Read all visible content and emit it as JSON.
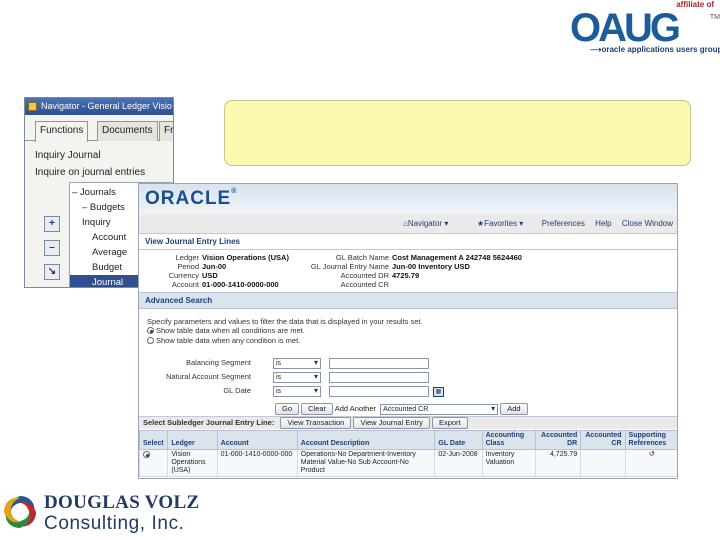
{
  "oaug": {
    "affiliate": "affiliate of",
    "word": "OAUG",
    "tagline": "oracle applications users group",
    "tm": "TM"
  },
  "navigator": {
    "title": "Navigator - General Ledger Visio",
    "tabs": [
      "Functions",
      "Documents",
      "Fr"
    ],
    "items": [
      "Inquiry Journal",
      "Inquire on journal entries"
    ],
    "tree": [
      {
        "label": "– Journals"
      },
      {
        "label": "– Budgets"
      },
      {
        "label": "Inquiry"
      },
      {
        "label": "Account"
      },
      {
        "label": "Average"
      },
      {
        "label": "Budget"
      },
      {
        "label": "Journal"
      }
    ],
    "buttons": [
      "+",
      "–",
      "↘"
    ]
  },
  "oracle": {
    "logo": "ORACLE",
    "links": {
      "navigator": "Navigator",
      "favorites": "Favorites",
      "preferences": "Preferences",
      "help": "Help",
      "close": "Close Window"
    },
    "section_title": "View Journal Entry Lines",
    "left_fields": [
      {
        "label": "Ledger",
        "value": "Vision Operations (USA)"
      },
      {
        "label": "Period",
        "value": "Jun-00"
      },
      {
        "label": "Currency",
        "value": "USD"
      },
      {
        "label": "Account",
        "value": "01-000-1410-0000-000"
      }
    ],
    "right_fields": [
      {
        "label": "GL Batch Name",
        "value": "Cost Management A 242748 5624460"
      },
      {
        "label": "GL Journal Entry Name",
        "value": "Jun-00 Inventory USD"
      },
      {
        "label": "Accounted DR",
        "value": "4725.79"
      },
      {
        "label": "Accounted CR",
        "value": ""
      }
    ],
    "advanced_search": "Advanced Search",
    "hint": "Specify parameters and values to filter the data that is displayed in your results set.",
    "radio_all": "Show table data when all conditions are met.",
    "radio_any": "Show table data when any condition is met.",
    "criteria": [
      {
        "label": "Balancing Segment",
        "op": "is"
      },
      {
        "label": "Natural Account Segment",
        "op": "is"
      },
      {
        "label": "GL Date",
        "op": "is"
      }
    ],
    "actions": {
      "go": "Go",
      "clear": "Clear",
      "add_another": "Add Another",
      "add_field": "Accounted CR",
      "add": "Add"
    },
    "toolbar": {
      "label": "Select Subledger Journal Entry Line:",
      "view_transaction": "View Transaction",
      "view_journal_entry": "View Journal Entry",
      "export": "Export"
    },
    "table": {
      "headers": [
        "Select",
        "Ledger",
        "Account",
        "Account Description",
        "GL Date",
        "Accounting Class",
        "Accounted DR",
        "Accounted CR",
        "Supporting References"
      ],
      "row": [
        "",
        "Vision Operations (USA)",
        "01-000-1410-0000-000",
        "Operations-No Department-Inventory Material Value-No Sub Account-No Product",
        "02-Jun-2008",
        "Inventory Valuation",
        "4,725.79",
        "",
        "↺"
      ]
    }
  },
  "douglas": {
    "line1": "DOUGLAS VOLZ",
    "line2": "Consulting, Inc."
  }
}
